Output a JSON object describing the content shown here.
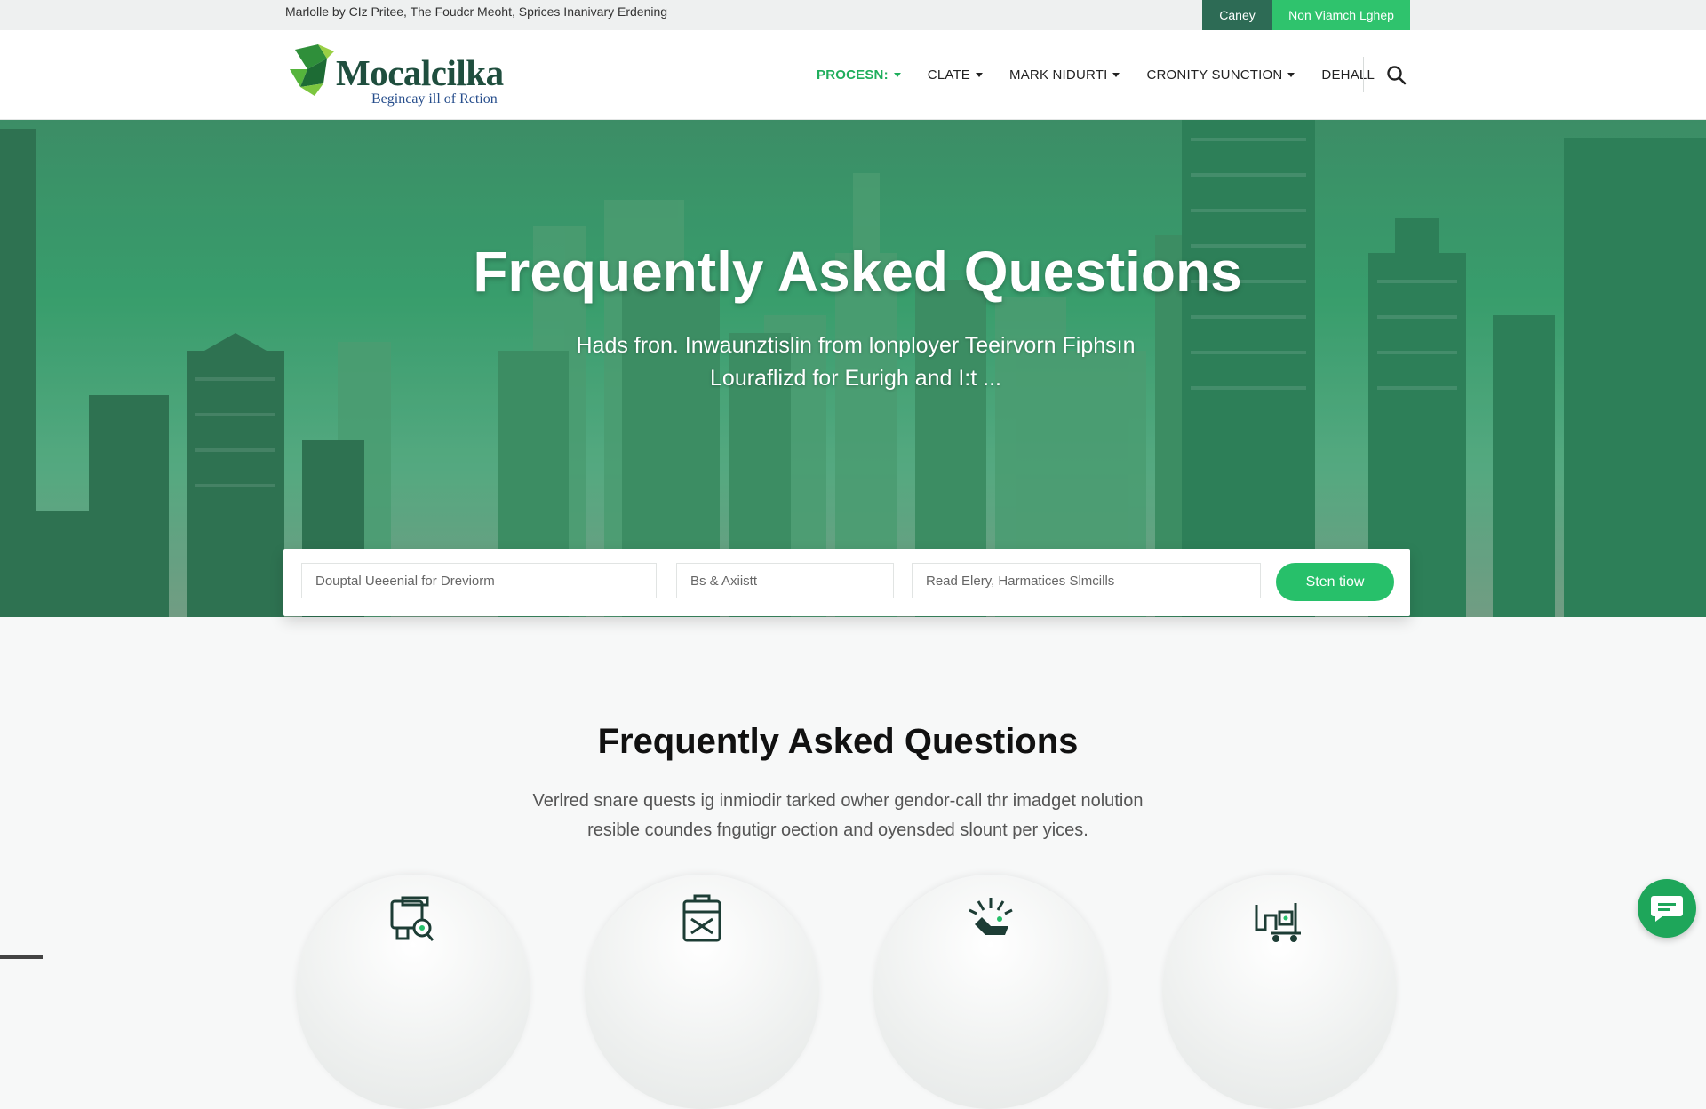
{
  "topbar": {
    "text": "Marlolle by  CIz  Pritee, The Foudcr Meoht, Sprices Inanivary Erdening",
    "btn_dark": "Caney",
    "btn_green": "Non Viamch Lghep"
  },
  "brand": {
    "name": "Mocalcilka",
    "tagline": "Begincay ill of Rction"
  },
  "nav": {
    "items": [
      "PROCESN:",
      "CLATE",
      "MARK NIDURTI",
      "CRONITY SUNCTION",
      "DEHALL"
    ]
  },
  "hero": {
    "title": "Frequently Asked Questions",
    "subtitle_line1": "Hads fron. Inwaunztislin from lonployer Teeirvorn Fiphsın",
    "subtitle_line2": "Louraflizd for Eurigh and Ι:t ..."
  },
  "search": {
    "field1_placeholder": "Douptal Ueeenial for Dreviorm",
    "field2_placeholder": "Bs & Axiistt",
    "field3_placeholder": "Read Elery, Harmatices Slmcills",
    "button_label": "Sten tiow"
  },
  "faq": {
    "title": "Frequently Asked Questions",
    "desc_line1": "Verlred snare quests ig inmiodir tarked owher gendor-call thr imadget nolution",
    "desc_line2": "resible coundes fngutigr oection and oyensded slount per yices."
  },
  "features": [
    {
      "icon": "monitor-search-icon"
    },
    {
      "icon": "building-icon"
    },
    {
      "icon": "celebration-hand-icon"
    },
    {
      "icon": "logistics-cart-icon"
    }
  ],
  "colors": {
    "accent": "#27c06a",
    "dark_green": "#2d6b55",
    "hero_tint": "#3a9b6c"
  }
}
